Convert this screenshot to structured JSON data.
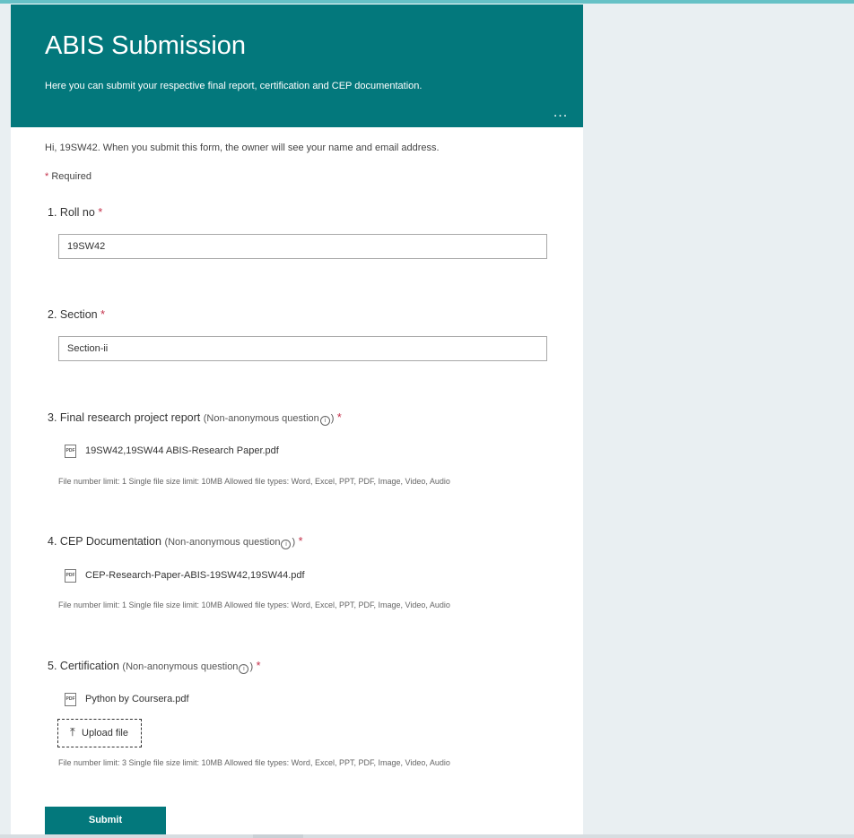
{
  "form": {
    "title": "ABIS Submission",
    "subtitle": "Here you can submit your respective final report, certification and  CEP documentation.",
    "more_options_label": "...",
    "notice": "Hi, 19SW42. When you submit this form, the owner will see your name and email address.",
    "required_star": "*",
    "required_label": "Required",
    "submit_label": "Submit",
    "info_glyph": "i",
    "pdf_icon_text": "PDF"
  },
  "questions": [
    {
      "number": "1.",
      "title": "Roll no",
      "value": "19SW42"
    },
    {
      "number": "2.",
      "title": "Section",
      "value": "Section-ii"
    },
    {
      "number": "3.",
      "title": "Final research project report",
      "qualifier_open": "(Non-anonymous question",
      "qualifier_close": ")",
      "file": "19SW42,19SW44 ABIS-Research Paper.pdf",
      "limits": "File number limit: 1    Single file size limit: 10MB    Allowed file types: Word, Excel, PPT, PDF, Image, Video, Audio"
    },
    {
      "number": "4.",
      "title": "CEP Documentation",
      "qualifier_open": "(Non-anonymous question",
      "qualifier_close": ")",
      "file": "CEP-Research-Paper-ABIS-19SW42,19SW44.pdf",
      "limits": "File number limit: 1    Single file size limit: 10MB    Allowed file types: Word, Excel, PPT, PDF, Image, Video, Audio"
    },
    {
      "number": "5.",
      "title": "Certification",
      "qualifier_open": "(Non-anonymous question",
      "qualifier_close": ")",
      "file": "Python by Coursera.pdf",
      "upload_label": "Upload file",
      "limits": "File number limit: 3    Single file size limit: 10MB    Allowed file types: Word, Excel, PPT, PDF, Image, Video, Audio"
    }
  ],
  "icons": {
    "more_options": "more-options-icon",
    "info": "info-icon",
    "pdf": "pdf-file-icon",
    "upload": "upload-arrow-icon"
  },
  "colors": {
    "header_teal": "#03787c",
    "required_red": "#c4314b",
    "page_background": "#e9eff2"
  }
}
